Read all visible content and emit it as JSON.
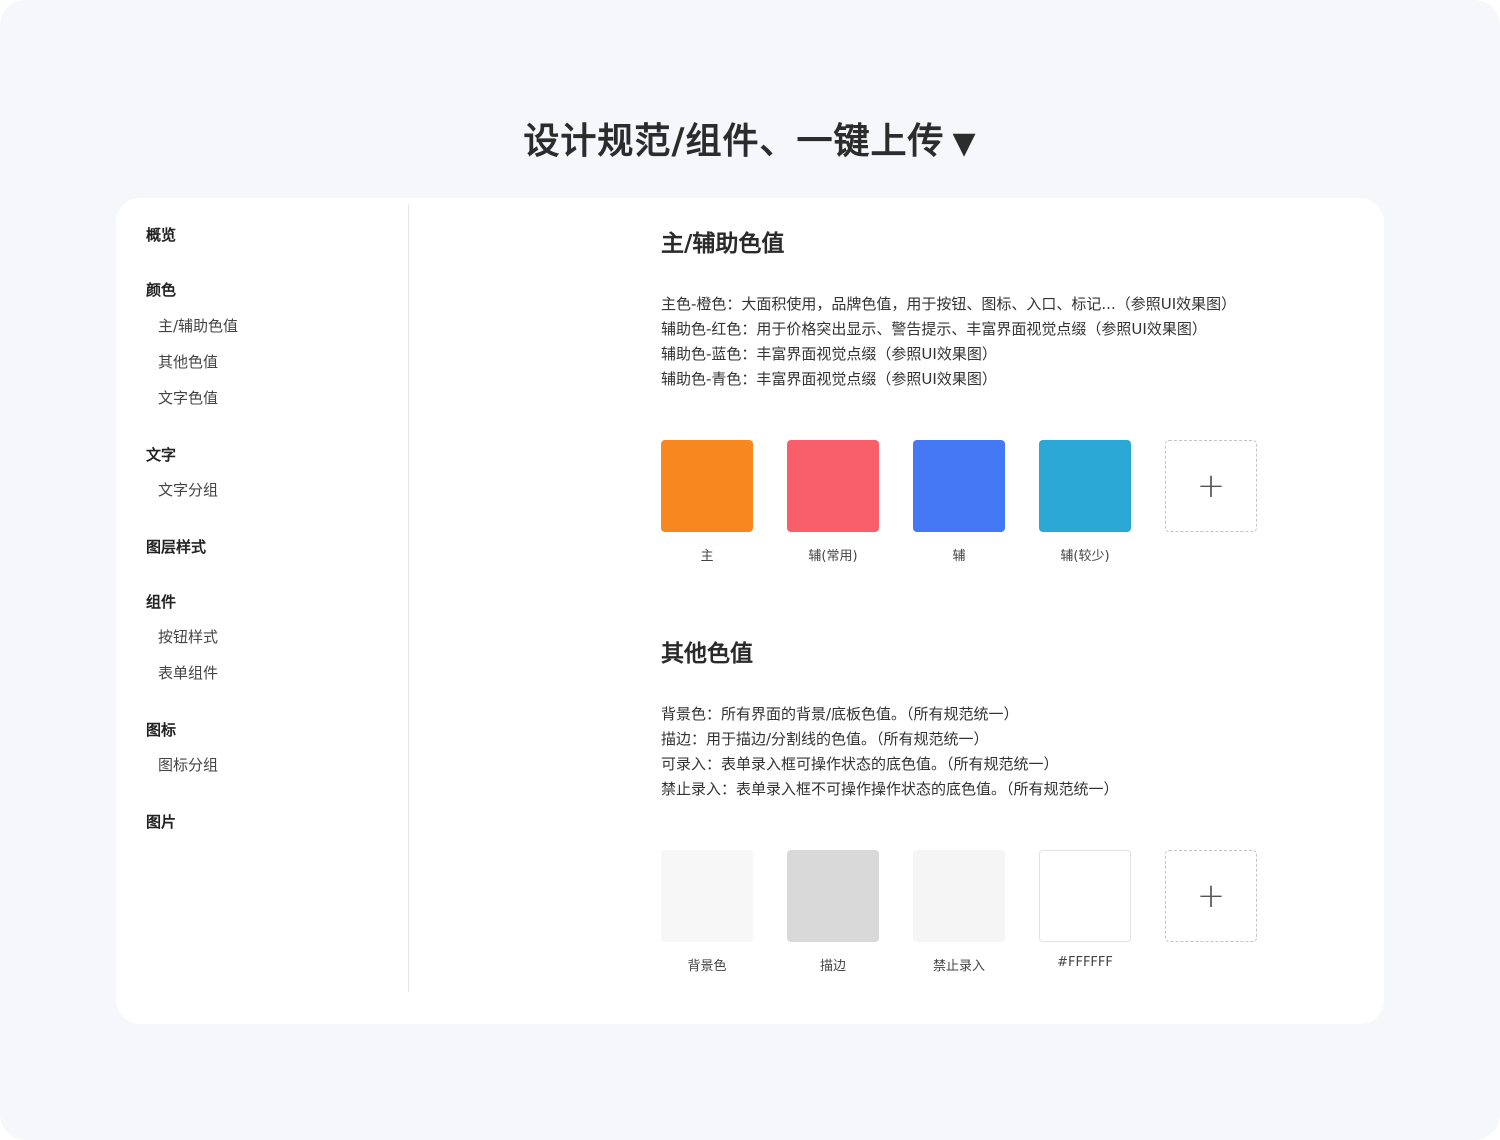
{
  "title": "设计规范/组件、一键上传",
  "title_arrow": "▼",
  "nav": [
    {
      "label": "概览",
      "type": "group"
    },
    {
      "label": "颜色",
      "type": "group"
    },
    {
      "label": "主/辅助色值",
      "type": "sub"
    },
    {
      "label": "其他色值",
      "type": "sub"
    },
    {
      "label": "文字色值",
      "type": "sub"
    },
    {
      "label": "文字",
      "type": "group"
    },
    {
      "label": "文字分组",
      "type": "sub"
    },
    {
      "label": "图层样式",
      "type": "group"
    },
    {
      "label": "组件",
      "type": "group"
    },
    {
      "label": "按钮样式",
      "type": "sub"
    },
    {
      "label": "表单组件",
      "type": "sub"
    },
    {
      "label": "图标",
      "type": "group"
    },
    {
      "label": "图标分组",
      "type": "sub"
    },
    {
      "label": "图片",
      "type": "group"
    }
  ],
  "sections": [
    {
      "title": "主/辅助色值",
      "lines": [
        "主色-橙色：大面积使用，品牌色值，用于按钮、图标、入口、标记...（参照UI效果图）",
        "辅助色-红色：用于价格突出显示、警告提示、丰富界面视觉点缀（参照UI效果图）",
        "辅助色-蓝色：丰富界面视觉点缀（参照UI效果图）",
        "辅助色-青色：丰富界面视觉点缀（参照UI效果图）"
      ],
      "swatches": [
        {
          "label": "主",
          "color": "#f7871e"
        },
        {
          "label": "辅(常用)",
          "color": "#f85f6b"
        },
        {
          "label": "辅",
          "color": "#4578f5"
        },
        {
          "label": "辅(较少)",
          "color": "#2ba8d6"
        }
      ],
      "add_symbol": "+"
    },
    {
      "title": "其他色值",
      "lines": [
        "背景色：所有界面的背景/底板色值。（所有规范统一）",
        "描边：用于描边/分割线的色值。（所有规范统一）",
        "可录入：表单录入框可操作状态的底色值。（所有规范统一）",
        "禁止录入：表单录入框不可操作操作状态的底色值。（所有规范统一）"
      ],
      "swatches": [
        {
          "label": "背景色",
          "color": "#f7f7f7"
        },
        {
          "label": "描边",
          "color": "#d9d9d9"
        },
        {
          "label": "禁止录入",
          "color": "#f5f5f5"
        },
        {
          "label": "#FFFFFF",
          "color": "#ffffff"
        }
      ],
      "add_symbol": "+"
    }
  ]
}
